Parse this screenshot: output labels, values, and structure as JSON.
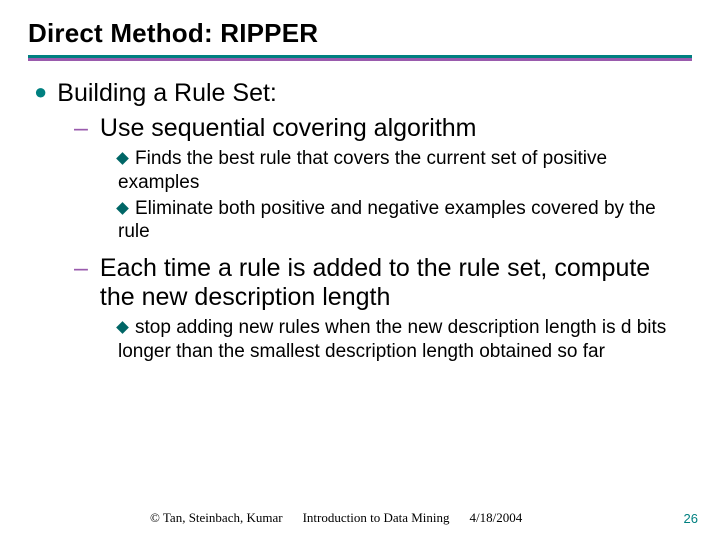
{
  "slide": {
    "title": "Direct Method: RIPPER",
    "l1": "Building a Rule Set:",
    "l2a": "Use sequential covering algorithm",
    "l3a1": "Finds the best rule that covers the current set of positive examples",
    "l3a2": "Eliminate both positive and negative examples covered by the rule",
    "l2b": "Each time a rule is added to the rule set, compute the new description length",
    "l3b1": "stop adding new rules when the new description length is d bits longer than the smallest description length obtained so far"
  },
  "footer": {
    "copyright": "© Tan, Steinbach, Kumar",
    "book": "Introduction to Data Mining",
    "date": "4/18/2004",
    "page": "26"
  }
}
